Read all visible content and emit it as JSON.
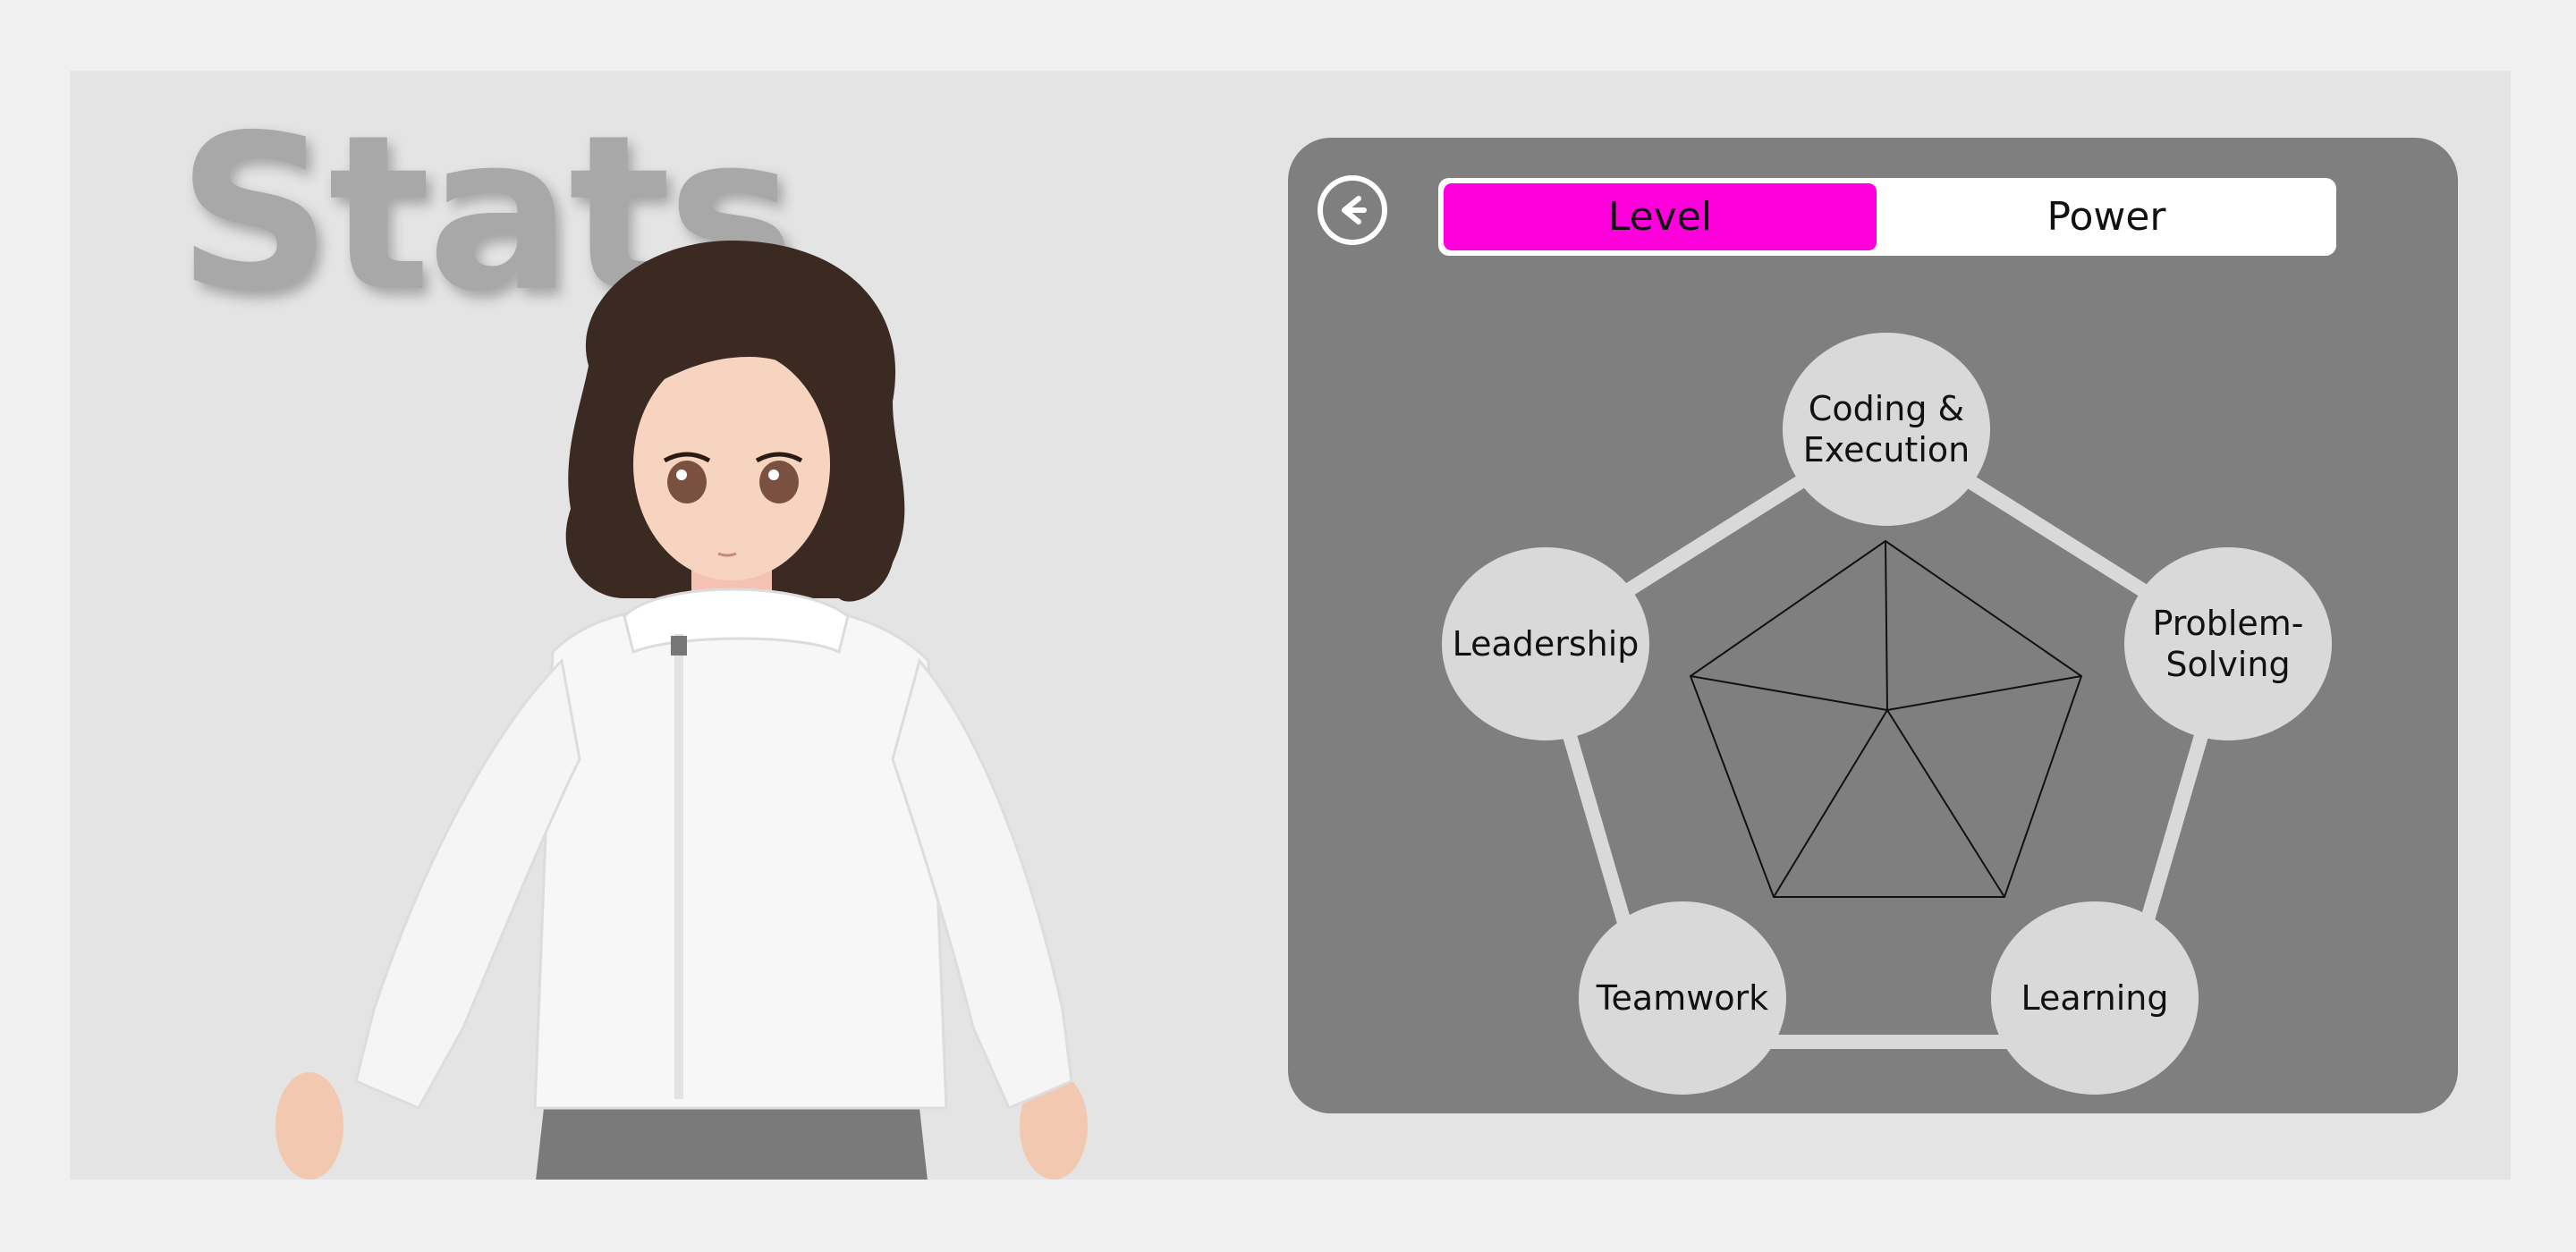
{
  "page": {
    "title": "Stats"
  },
  "colors": {
    "accent": "#ff00dd",
    "panel": "#7f7f7f",
    "node": "#d9d9d9"
  },
  "toggle": {
    "options": [
      {
        "label": "Level",
        "selected": true
      },
      {
        "label": "Power",
        "selected": false
      }
    ]
  },
  "back": {
    "icon": "arrow-left-circle-icon"
  },
  "skills": [
    {
      "label": "Coding & Execution",
      "lines": [
        "Coding &",
        "Execution"
      ]
    },
    {
      "label": "Problem-Solving",
      "lines": [
        "Problem-",
        "Solving"
      ]
    },
    {
      "label": "Learning",
      "lines": [
        "Learning"
      ]
    },
    {
      "label": "Teamwork",
      "lines": [
        "Teamwork"
      ]
    },
    {
      "label": "Leadership",
      "lines": [
        "Leadership"
      ]
    }
  ]
}
